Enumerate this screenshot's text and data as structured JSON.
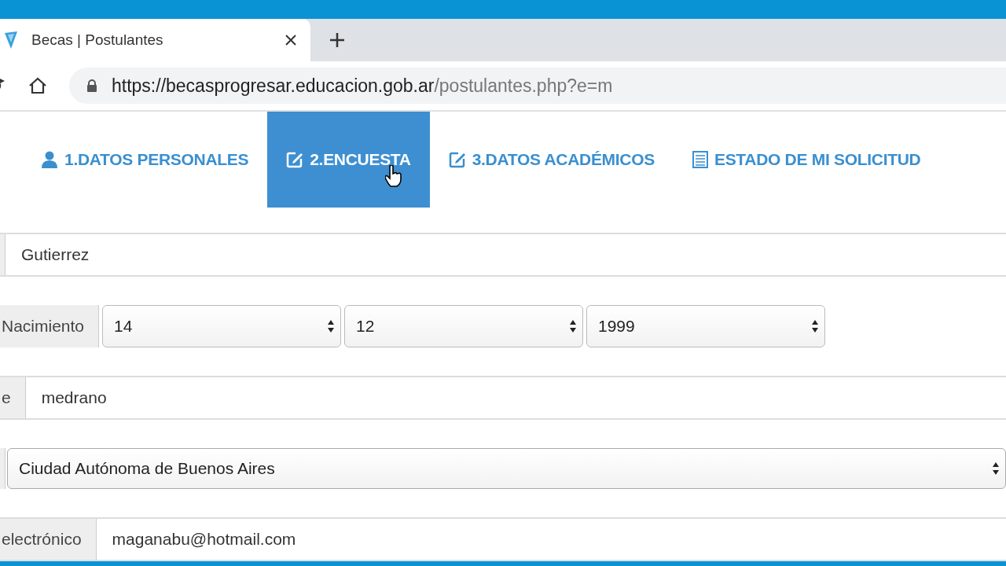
{
  "browser": {
    "tab_title": "Becas | Postulantes",
    "url_origin": "https://becasprogresar.educacion.gob.ar",
    "url_path": "/postulantes.php?e=m"
  },
  "nav_tabs": [
    {
      "kind": "user",
      "label": "1.DATOS PERSONALES",
      "selected": false
    },
    {
      "kind": "edit",
      "label": "2.ENCUESTA",
      "selected": true
    },
    {
      "kind": "edit",
      "label": "3.DATOS ACADÉMICOS",
      "selected": false
    },
    {
      "kind": "list",
      "label": "ESTADO DE MI SOLICITUD",
      "selected": false
    }
  ],
  "form_rows": [
    {
      "kind": "input",
      "value": "Gutierrez"
    },
    {
      "kind": "date",
      "label": "Nacimiento",
      "selects": [
        "14",
        "12",
        "1999"
      ]
    },
    {
      "kind": "input",
      "label": "e",
      "value": "medrano"
    },
    {
      "kind": "select",
      "value": "Ciudad Autónoma de Buenos Aires"
    },
    {
      "kind": "input",
      "label": "electrónico",
      "value": "maganabu@hotmail.com"
    }
  ]
}
